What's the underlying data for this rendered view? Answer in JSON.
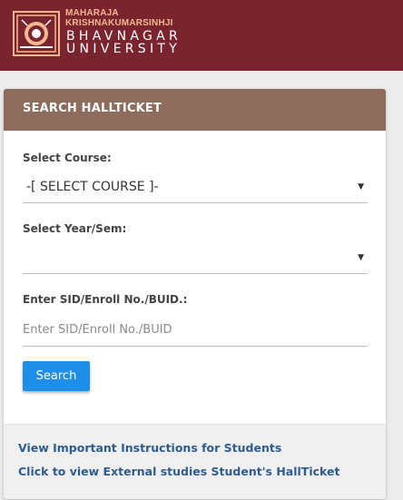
{
  "header": {
    "logo_line1": "MAHARAJA",
    "logo_line2": "KRISHNAKUMARSINHJI",
    "logo_line3": "BHAVNAGAR",
    "logo_line4": "UNIVERSITY",
    "colors": {
      "background": "#7a2430",
      "accent": "#f5b88c"
    }
  },
  "card": {
    "title": "SEARCH HALLTICKET",
    "header_color": "#8d6c5d",
    "course": {
      "label": "Select Course:",
      "selected": "-[ SELECT COURSE ]-"
    },
    "year_sem": {
      "label": "Select Year/Sem:",
      "selected": ""
    },
    "sid": {
      "label": "Enter SID/Enroll No./BUID.:",
      "placeholder": "Enter SID/Enroll No./BUID",
      "value": ""
    },
    "search_button": {
      "label": "Search",
      "color": "#1f8ee8"
    },
    "links": [
      {
        "label": "View Important Instructions for Students"
      },
      {
        "label": "Click to view External studies Student's HallTicket"
      }
    ]
  }
}
